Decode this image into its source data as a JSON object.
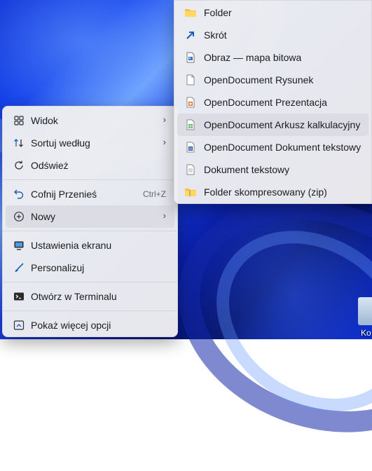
{
  "main_menu": {
    "items": [
      {
        "icon": "grid-icon",
        "label": "Widok",
        "arrow": "›"
      },
      {
        "icon": "sort-icon",
        "label": "Sortuj według",
        "arrow": "›"
      },
      {
        "icon": "refresh-icon",
        "label": "Odśwież"
      },
      {
        "icon": "undo-icon",
        "label": "Cofnij Przenieś",
        "shortcut": "Ctrl+Z"
      },
      {
        "icon": "plus-circle-icon",
        "label": "Nowy",
        "arrow": "›"
      },
      {
        "icon": "display-icon",
        "label": "Ustawienia ekranu"
      },
      {
        "icon": "brush-icon",
        "label": "Personalizuj"
      },
      {
        "icon": "terminal-icon",
        "label": "Otwórz w Terminalu"
      },
      {
        "icon": "more-options-icon",
        "label": "Pokaż więcej opcji"
      }
    ]
  },
  "sub_menu": {
    "items": [
      {
        "icon": "folder-icon",
        "label": "Folder"
      },
      {
        "icon": "shortcut-icon",
        "label": "Skrót"
      },
      {
        "icon": "bitmap-icon",
        "label": "Obraz — mapa bitowa"
      },
      {
        "icon": "odg-icon",
        "label": "OpenDocument Rysunek"
      },
      {
        "icon": "odp-icon",
        "label": "OpenDocument Prezentacja"
      },
      {
        "icon": "ods-icon",
        "label": "OpenDocument Arkusz kalkulacyjny"
      },
      {
        "icon": "odt-icon",
        "label": "OpenDocument Dokument tekstowy"
      },
      {
        "icon": "text-file-icon",
        "label": "Dokument tekstowy"
      },
      {
        "icon": "zip-folder-icon",
        "label": "Folder skompresowany (zip)"
      }
    ]
  },
  "desktop": {
    "recycle_label": "Ko"
  }
}
